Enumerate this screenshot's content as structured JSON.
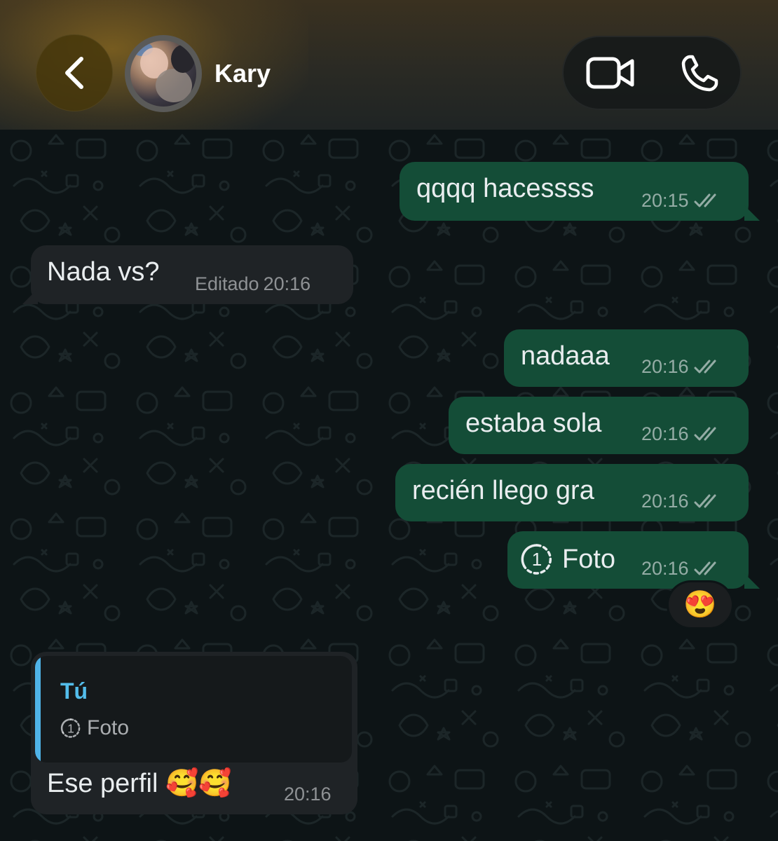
{
  "header": {
    "contact_name": "Kary",
    "back_icon": "chevron-left-icon",
    "video_icon": "video-camera-icon",
    "phone_icon": "phone-icon"
  },
  "messages": [
    {
      "direction": "out",
      "text": "qqqq hacessss",
      "time": "20:15",
      "status": "double-check"
    },
    {
      "direction": "in",
      "text": "Nada vs?",
      "edited_label": "Editado",
      "time": "20:16"
    },
    {
      "direction": "out",
      "text": "nadaaa",
      "time": "20:16",
      "status": "double-check"
    },
    {
      "direction": "out",
      "text": "estaba sola",
      "time": "20:16",
      "status": "double-check"
    },
    {
      "direction": "out",
      "text": "recién llego gra",
      "time": "20:16",
      "status": "double-check"
    },
    {
      "direction": "out",
      "text": "Foto",
      "icon": "view-once-icon",
      "view_once_count": "1",
      "time": "20:16",
      "status": "double-check",
      "reaction": "😍"
    },
    {
      "direction": "in",
      "reply_to": {
        "author": "Tú",
        "text": "Foto",
        "icon": "view-once-icon",
        "view_once_count": "1"
      },
      "text": "Ese perfil 🥰🥰",
      "time": "20:16"
    }
  ],
  "colors": {
    "outgoing_bubble": "#144d37",
    "incoming_bubble": "#1f2326",
    "quote_accent": "#4fb3e8",
    "header_accent": "#b0821e"
  }
}
